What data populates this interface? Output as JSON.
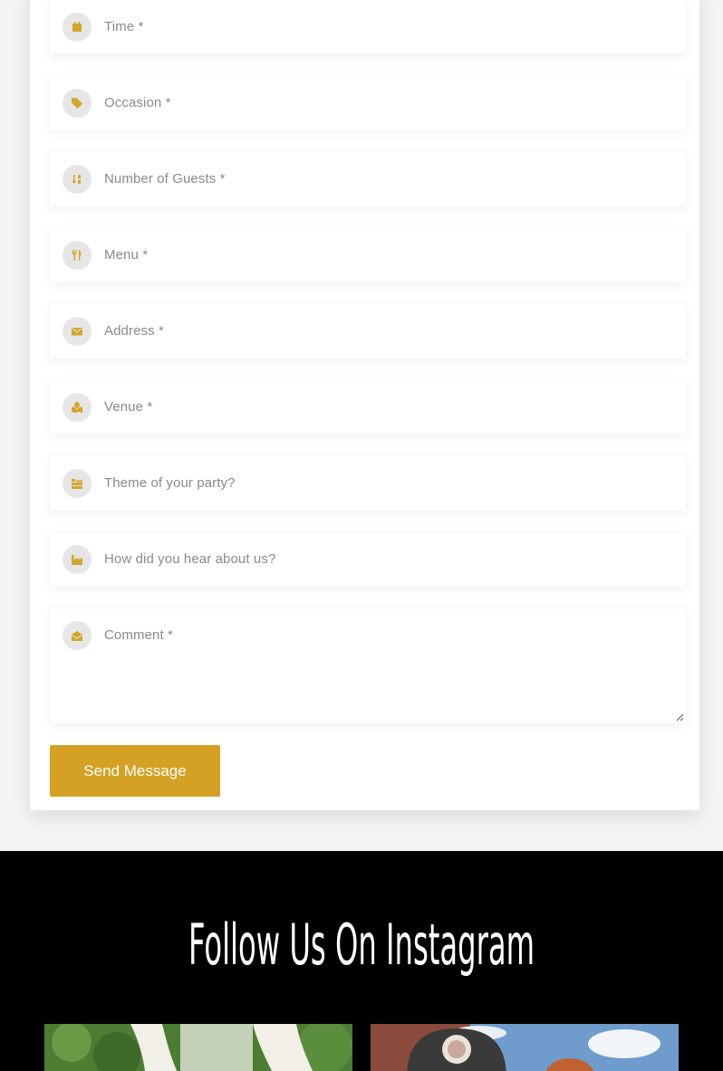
{
  "form": {
    "fields": [
      {
        "icon": "calendar-icon",
        "placeholder": "Time *"
      },
      {
        "icon": "tag-icon",
        "placeholder": "Occasion *"
      },
      {
        "icon": "sort-numeric-icon",
        "placeholder": "Number of Guests *"
      },
      {
        "icon": "utensils-icon",
        "placeholder": "Menu *"
      },
      {
        "icon": "envelope-icon",
        "placeholder": "Address *"
      },
      {
        "icon": "map-marked-icon",
        "placeholder": "Venue *"
      },
      {
        "icon": "layers-icon",
        "placeholder": "Theme of your party?"
      },
      {
        "icon": "industry-icon",
        "placeholder": "How did you hear about us?"
      },
      {
        "icon": "envelope-open-icon",
        "placeholder": "Comment *"
      }
    ],
    "submit_label": "Send Message"
  },
  "instagram": {
    "title": "Follow Us On Instagram"
  },
  "colors": {
    "accent": "#d4a124",
    "icon_bg": "#e6e6e6",
    "placeholder": "#8a8a8a",
    "section_bg": "#000000"
  }
}
